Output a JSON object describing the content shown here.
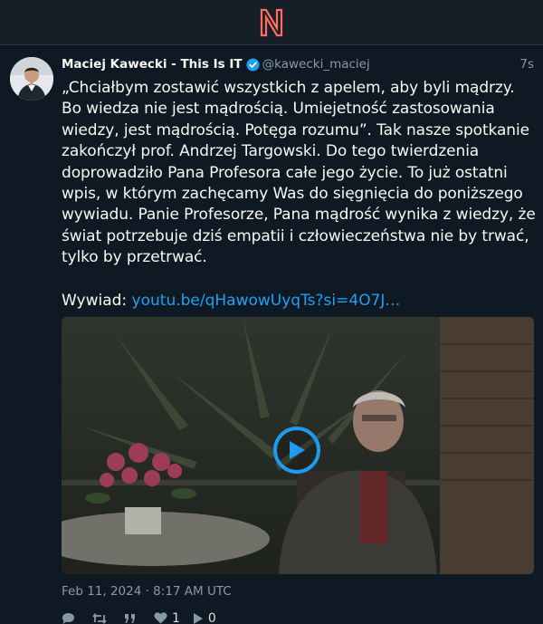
{
  "app": {
    "logo": "nitter-logo",
    "brand_color": "#ff6c60"
  },
  "tweet": {
    "fullname": "Maciej Kawecki - This Is IT",
    "username": "@kawecki_maciej",
    "time_ago": "7s",
    "verified_icon": "verified-badge-icon",
    "text": "„Chciałbym zostawić wszystkich z apelem, aby byli mądrzy. Bo wiedza nie jest mądrością. Umiejetność zastosowania wiedzy, jest mądrością. Potęga rozumu”. Tak nasze spotkanie zakończył prof. Andrzej Targowski. Do tego twierdzenia doprowadziło Pana Profesora całe jego życie. To już ostatni wpis, w którym zachęcamy Was do sięgnięcia do poniższego wywiadu. Panie Profesorze, Pana mądrość wynika z wiedzy, że świat potrzebuje dziś empatii i człowieczeństwa nie by trwać, tylko by przetrwać.",
    "link_prefix": "Wywiad: ",
    "link_text": "youtu.be/qHawowUyqTs?si=4O7J…",
    "published": "Feb 11, 2024 · 8:17 AM UTC",
    "media": {
      "type": "video",
      "play_icon": "play-icon"
    },
    "stats": {
      "replies": "",
      "retweets": "",
      "quotes": "",
      "likes": "1",
      "views": "0"
    }
  },
  "colors": {
    "background": "#0f1924",
    "header": "#161e27",
    "accent": "#1da1f2",
    "muted": "#8899a6"
  }
}
